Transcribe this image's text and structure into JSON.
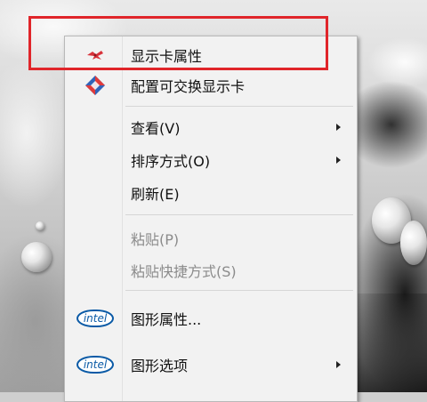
{
  "context_menu": {
    "items": [
      {
        "label": "显示卡属性",
        "icon": "graphics-card-icon",
        "disabled": false,
        "submenu": false
      },
      {
        "label": "配置可交换显示卡",
        "icon": "switchable-graphics-icon",
        "disabled": false,
        "submenu": false
      },
      {
        "label": "查看(V)",
        "icon": "",
        "disabled": false,
        "submenu": true
      },
      {
        "label": "排序方式(O)",
        "icon": "",
        "disabled": false,
        "submenu": true
      },
      {
        "label": "刷新(E)",
        "icon": "",
        "disabled": false,
        "submenu": false
      },
      {
        "label": "粘贴(P)",
        "icon": "",
        "disabled": true,
        "submenu": false
      },
      {
        "label": "粘贴快捷方式(S)",
        "icon": "",
        "disabled": true,
        "submenu": false
      },
      {
        "label": "图形属性...",
        "icon": "intel-logo-icon",
        "disabled": false,
        "submenu": false
      },
      {
        "label": "图形选项",
        "icon": "intel-logo-icon",
        "disabled": false,
        "submenu": true
      }
    ],
    "intel_text": "intel"
  },
  "colors": {
    "highlight_border": "#e0252a",
    "menu_background": "#f2f2f2",
    "intel_blue": "#0a5aa6"
  }
}
